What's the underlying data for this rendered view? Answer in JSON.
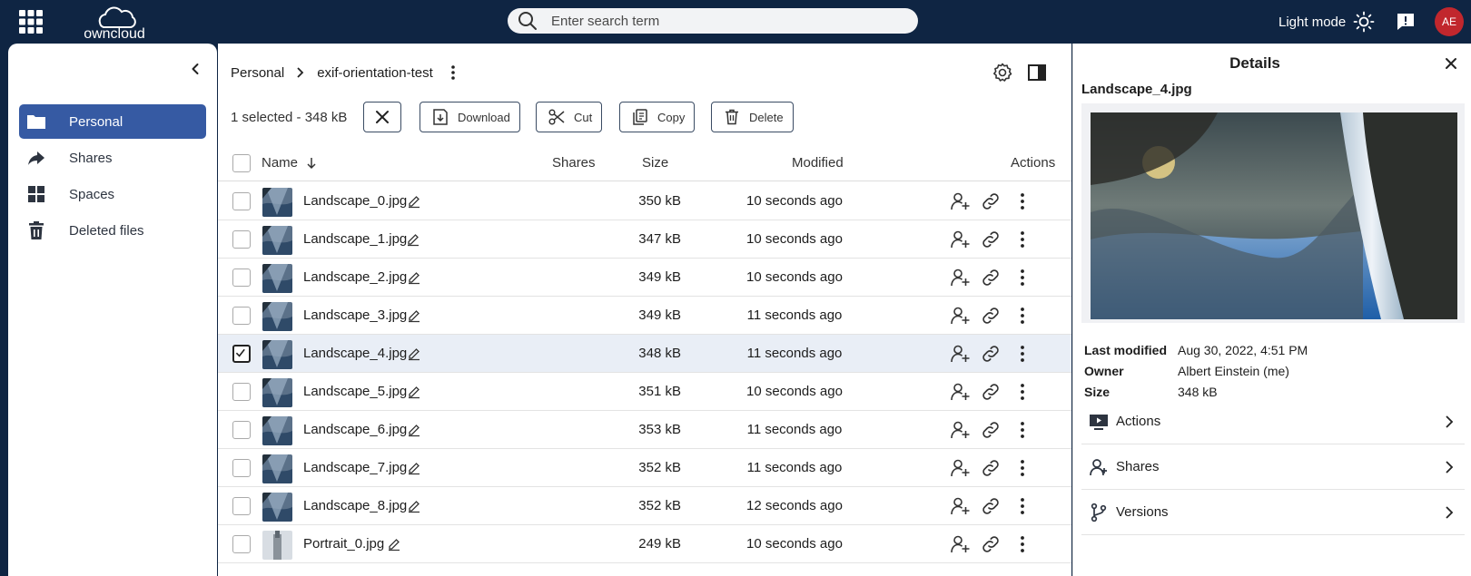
{
  "topbar": {
    "search_placeholder": "Enter search term",
    "light_mode_label": "Light mode",
    "avatar_initials": "AE",
    "logo_text": "owncloud"
  },
  "sidebar": {
    "items": [
      {
        "label": "Personal",
        "icon": "folder-icon",
        "active": true
      },
      {
        "label": "Shares",
        "icon": "share-arrow-icon",
        "active": false
      },
      {
        "label": "Spaces",
        "icon": "grid-icon",
        "active": false
      },
      {
        "label": "Deleted files",
        "icon": "trash-icon",
        "active": false
      }
    ]
  },
  "breadcrumb": {
    "root": "Personal",
    "current": "exif-orientation-test"
  },
  "selection": {
    "text": "1 selected - 348 kB",
    "download_label": "Download",
    "cut_label": "Cut",
    "copy_label": "Copy",
    "delete_label": "Delete"
  },
  "table": {
    "headers": {
      "name": "Name",
      "shares": "Shares",
      "size": "Size",
      "modified": "Modified",
      "actions": "Actions"
    },
    "rows": [
      {
        "name": "Landscape_0.jpg",
        "size": "350 kB",
        "modified": "10 seconds ago",
        "selected": false
      },
      {
        "name": "Landscape_1.jpg",
        "size": "347 kB",
        "modified": "10 seconds ago",
        "selected": false
      },
      {
        "name": "Landscape_2.jpg",
        "size": "349 kB",
        "modified": "10 seconds ago",
        "selected": false
      },
      {
        "name": "Landscape_3.jpg",
        "size": "349 kB",
        "modified": "11 seconds ago",
        "selected": false
      },
      {
        "name": "Landscape_4.jpg",
        "size": "348 kB",
        "modified": "11 seconds ago",
        "selected": true
      },
      {
        "name": "Landscape_5.jpg",
        "size": "351 kB",
        "modified": "10 seconds ago",
        "selected": false
      },
      {
        "name": "Landscape_6.jpg",
        "size": "353 kB",
        "modified": "11 seconds ago",
        "selected": false
      },
      {
        "name": "Landscape_7.jpg",
        "size": "352 kB",
        "modified": "11 seconds ago",
        "selected": false
      },
      {
        "name": "Landscape_8.jpg",
        "size": "352 kB",
        "modified": "12 seconds ago",
        "selected": false
      },
      {
        "name": "Portrait_0.jpg",
        "size": "249 kB",
        "modified": "10 seconds ago",
        "selected": false
      }
    ]
  },
  "details": {
    "title": "Details",
    "file_name": "Landscape_4.jpg",
    "last_modified_label": "Last modified",
    "last_modified_value": "Aug 30, 2022, 4:51 PM",
    "owner_label": "Owner",
    "owner_value": "Albert Einstein (me)",
    "size_label": "Size",
    "size_value": "348 kB",
    "sections": [
      "Actions",
      "Shares",
      "Versions"
    ]
  },
  "colors": {
    "topbar_bg": "#0f2543",
    "accent": "#365aa3",
    "avatar": "#c1272d",
    "selected_row": "#e9eef6"
  }
}
